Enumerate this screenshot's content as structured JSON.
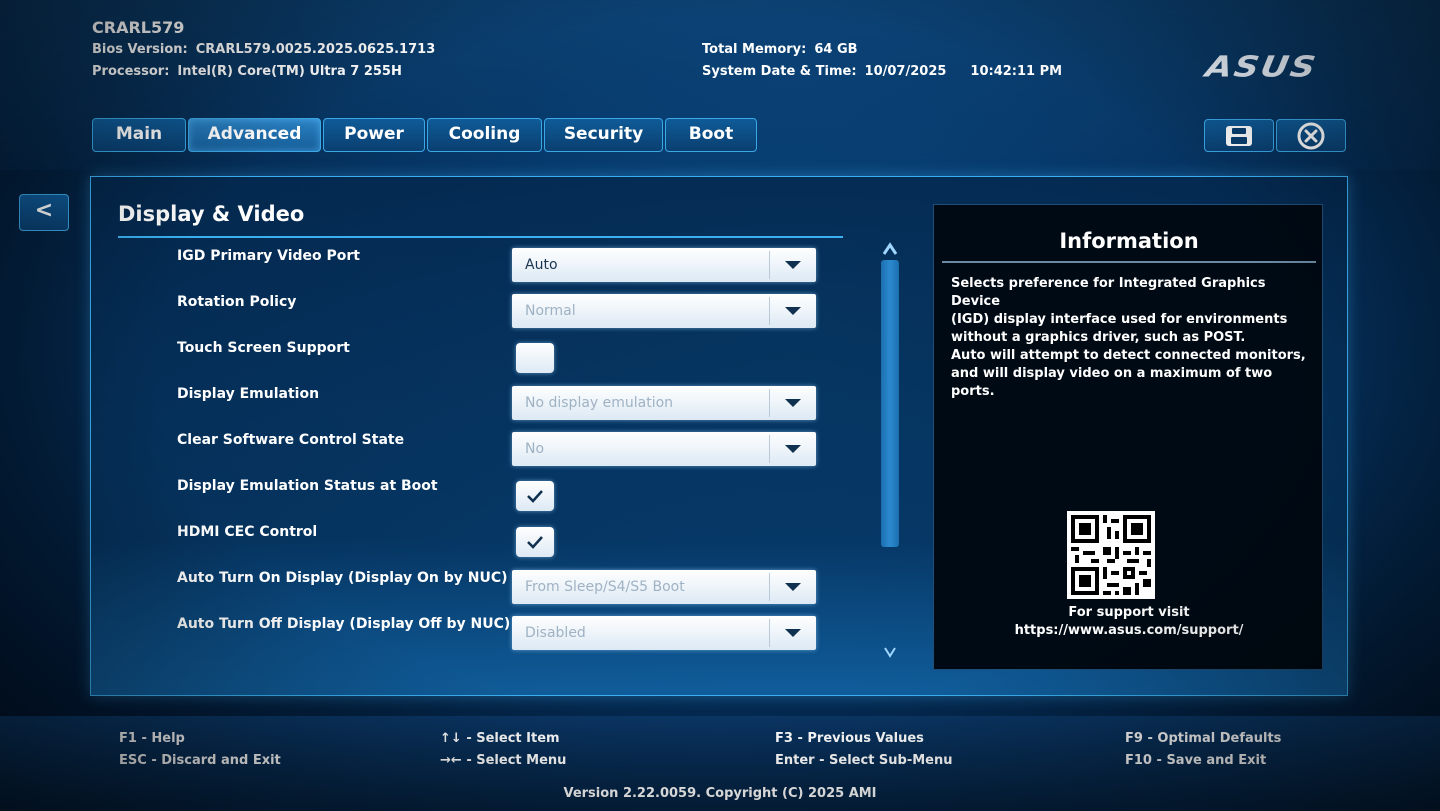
{
  "header": {
    "title": "CRARL579",
    "bios_version_label": "Bios Version:",
    "bios_version": "CRARL579.0025.2025.0625.1713",
    "processor_label": "Processor:",
    "processor": "Intel(R) Core(TM) Ultra 7 255H",
    "total_memory_label": "Total Memory:",
    "total_memory": "64 GB",
    "system_datetime_label": "System Date & Time:",
    "system_date": "10/07/2025",
    "system_time": "10:42:11 PM",
    "logo_text": "ASUS"
  },
  "tabs": [
    {
      "label": "Main"
    },
    {
      "label": "Advanced",
      "active": true
    },
    {
      "label": "Power"
    },
    {
      "label": "Cooling"
    },
    {
      "label": "Security"
    },
    {
      "label": "Boot"
    }
  ],
  "icons": {
    "save": "save-icon",
    "exit": "close-circle-icon",
    "back_label": "<"
  },
  "section": {
    "title": "Display & Video"
  },
  "settings": [
    {
      "label": "IGD Primary Video Port",
      "type": "dropdown",
      "value": "Auto",
      "enabled": true
    },
    {
      "label": "Rotation Policy",
      "type": "dropdown",
      "value": "Normal",
      "enabled": false
    },
    {
      "label": "Touch Screen Support",
      "type": "checkbox",
      "checked": false
    },
    {
      "label": "Display Emulation",
      "type": "dropdown",
      "value": "No display emulation",
      "enabled": false
    },
    {
      "label": "Clear Software Control State",
      "type": "dropdown",
      "value": "No",
      "enabled": false
    },
    {
      "label": "Display Emulation Status at Boot",
      "type": "checkbox",
      "checked": true
    },
    {
      "label": "HDMI CEC Control",
      "type": "checkbox",
      "checked": true
    },
    {
      "label": "Auto Turn On Display (Display On by NUC)",
      "type": "dropdown",
      "value": "From Sleep/S4/S5 Boot",
      "enabled": false
    },
    {
      "label": "Auto Turn Off Display (Display Off by NUC)",
      "type": "dropdown",
      "value": "Disabled",
      "enabled": false
    }
  ],
  "info": {
    "title": "Information",
    "lines": [
      "Selects preference for Integrated Graphics Device",
      "(IGD) display interface used for environments",
      "without a graphics driver, such as POST.",
      "Auto will attempt to detect connected monitors,",
      "and will display video on a maximum of two ports."
    ],
    "support_line1": "For support visit",
    "support_line2": "https://www.asus.com/support/"
  },
  "footer": {
    "keys": [
      {
        "key": "F1",
        "desc": "Help"
      },
      {
        "key": "ESC",
        "desc": "Discard and Exit"
      },
      {
        "key": "↑↓",
        "desc": "Select Item"
      },
      {
        "key": "→←",
        "desc": "Select Menu"
      },
      {
        "key": "F3",
        "desc": "Previous Values"
      },
      {
        "key": "Enter",
        "desc": "Select Sub-Menu"
      },
      {
        "key": "F9",
        "desc": "Optimal Defaults"
      },
      {
        "key": "F10",
        "desc": "Save and Exit"
      }
    ],
    "version": "Version 2.22.0059. Copyright (C) 2025 AMI"
  },
  "colors": {
    "accent": "#3ab0f0",
    "background": "#063768",
    "info_background": "#000a14"
  }
}
